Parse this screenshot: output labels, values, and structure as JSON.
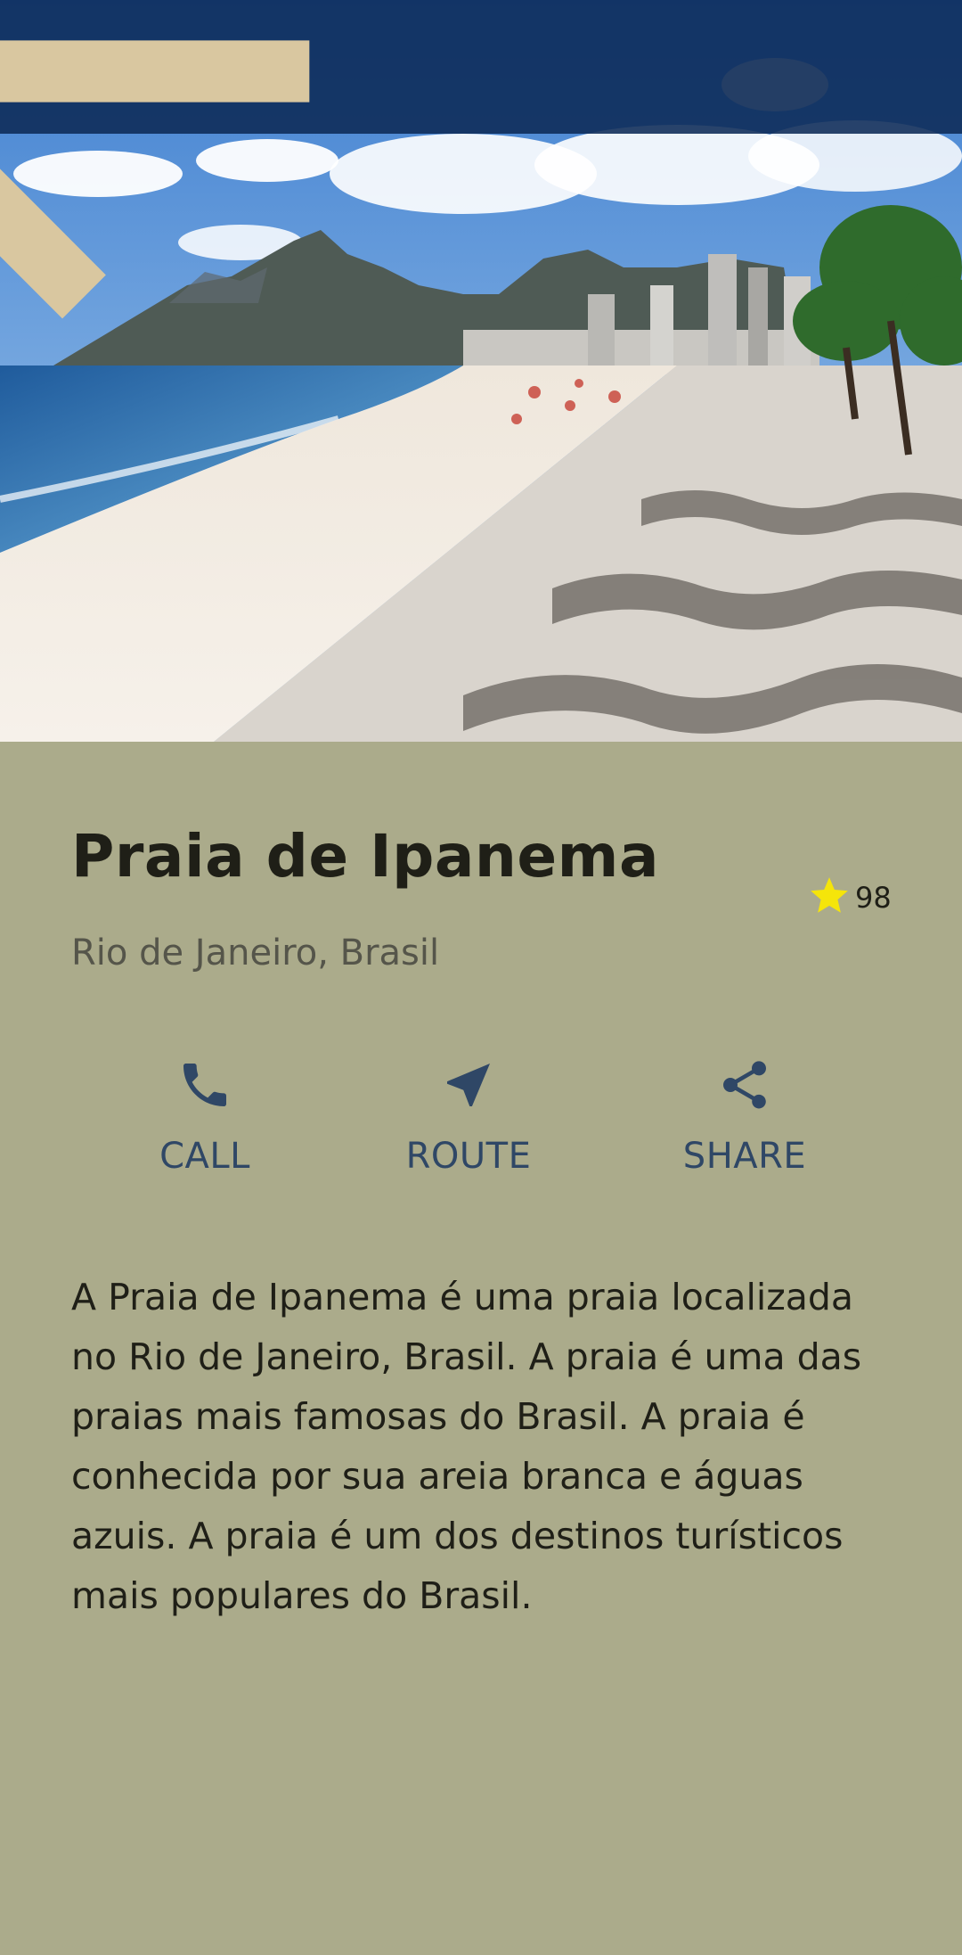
{
  "place": {
    "title": "Praia de Ipanema",
    "location": "Rio de Janeiro, Brasil",
    "rating_count": "98",
    "description": "A Praia de Ipanema é uma praia localizada no Rio de Janeiro, Brasil. A praia é uma das praias mais famosas do Brasil. A praia é conhecida por sua areia branca e águas azuis. A praia é um dos destinos turísticos mais populares do Brasil."
  },
  "actions": {
    "call_label": "CALL",
    "route_label": "ROUTE",
    "share_label": "SHARE"
  },
  "icons": {
    "back": "arrow-back-icon",
    "star": "star-icon",
    "call": "phone-icon",
    "route": "navigation-arrow-icon",
    "share": "share-icon"
  },
  "colors": {
    "appbar": "#0d2a56",
    "background": "#abab8b",
    "accent": "#2f4766",
    "star": "#f5e50a"
  }
}
